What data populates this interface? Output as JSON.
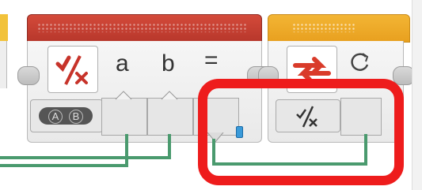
{
  "block1": {
    "params": [
      "a",
      "b",
      "="
    ],
    "mode_button_letters": [
      "A",
      "B"
    ],
    "colors": {
      "header": "#c2392c",
      "wire": "#4a9a6e"
    }
  },
  "block2": {
    "colors": {
      "header": "#f0ab28"
    }
  },
  "highlight": {
    "color": "#ee1c1c"
  },
  "icons": {
    "block1_mode": "not-equal-compare-icon",
    "block2_mode": "loop-interrupt-icon",
    "block2_param": "rotate-refresh-icon",
    "block2_input": "compare-check-icon"
  }
}
